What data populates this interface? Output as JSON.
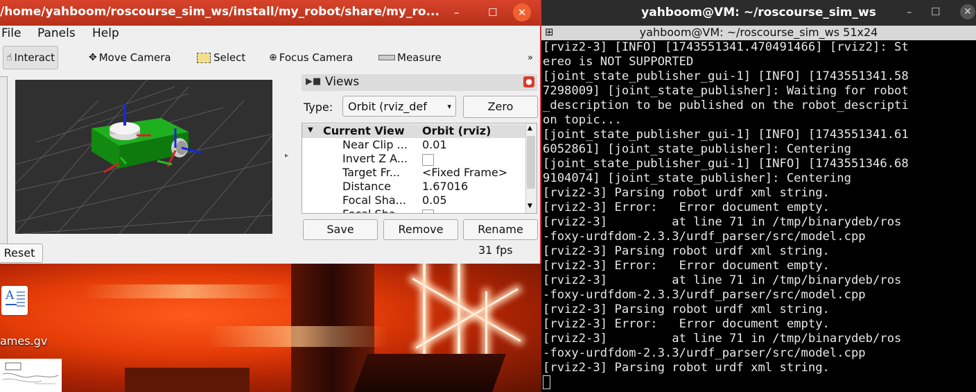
{
  "rviz": {
    "title": "/home/yahboom/roscourse_sim_ws/install/my_robot/share/my_ro...",
    "min": "–",
    "max": "☐",
    "close": "✕",
    "menu": [
      "File",
      "Panels",
      "Help"
    ],
    "tools": {
      "interact": "Interact",
      "move_camera": "Move Camera",
      "select": "Select",
      "focus_camera": "Focus Camera",
      "measure": "Measure",
      "more": "»"
    },
    "reset": "Reset",
    "views": {
      "title": "Views",
      "type_label": "Type:",
      "type_value": "Orbit (rviz_def",
      "zero": "Zero",
      "header": {
        "name": "Current View",
        "value": "Orbit (rviz)"
      },
      "props": [
        {
          "name": "Near Clip ...",
          "value": "0.01"
        },
        {
          "name": "Invert Z A...",
          "value": ""
        },
        {
          "name": "Target Fr...",
          "value": "<Fixed Frame>"
        },
        {
          "name": "Distance",
          "value": "1.67016"
        },
        {
          "name": "Focal Sha...",
          "value": "0.05"
        },
        {
          "name": "Focal Sha...",
          "value": ""
        }
      ],
      "save": "Save",
      "remove": "Remove",
      "rename": "Rename",
      "fps": "31 fps"
    }
  },
  "desktop": {
    "icon_label": "ames.gv"
  },
  "terminal": {
    "title": "yahboom@VM: ~/roscourse_sim_ws",
    "subtitle": "yahboom@VM: ~/roscourse_sim_ws 51x24",
    "min": "–",
    "max": "☐",
    "close": "✕",
    "lines": [
      "[rviz2-3] [INFO] [1743551341.470491466] [rviz2]: St",
      "ereo is NOT SUPPORTED",
      "[joint_state_publisher_gui-1] [INFO] [1743551341.58",
      "7298009] [joint_state_publisher]: Waiting for robot",
      "_description to be published on the robot_descripti",
      "on topic...",
      "[joint_state_publisher_gui-1] [INFO] [1743551341.61",
      "6052861] [joint_state_publisher]: Centering",
      "[joint_state_publisher_gui-1] [INFO] [1743551346.68",
      "9104074] [joint_state_publisher]: Centering",
      "[rviz2-3] Parsing robot urdf xml string.",
      "[rviz2-3] Error:   Error document empty.",
      "[rviz2-3]         at line 71 in /tmp/binarydeb/ros",
      "-foxy-urdfdom-2.3.3/urdf_parser/src/model.cpp",
      "[rviz2-3] Parsing robot urdf xml string.",
      "[rviz2-3] Error:   Error document empty.",
      "[rviz2-3]         at line 71 in /tmp/binarydeb/ros",
      "-foxy-urdfdom-2.3.3/urdf_parser/src/model.cpp",
      "[rviz2-3] Parsing robot urdf xml string.",
      "[rviz2-3] Error:   Error document empty.",
      "[rviz2-3]         at line 71 in /tmp/binarydeb/ros",
      "-foxy-urdfdom-2.3.3/urdf_parser/src/model.cpp",
      "[rviz2-3] Parsing robot urdf xml string."
    ]
  },
  "colors": {
    "rviz_titlebar": "#c33b21",
    "terminal_bg": "#000000",
    "robot_body": "#1a9a1a"
  }
}
